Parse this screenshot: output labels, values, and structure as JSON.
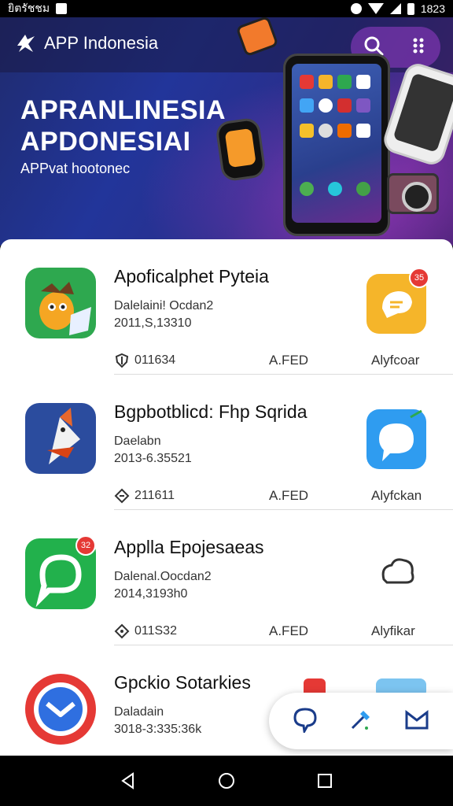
{
  "status_bar": {
    "left_text": "ยิตรัชชม",
    "time": "1823"
  },
  "header": {
    "app_name": "APP Indonesia"
  },
  "hero": {
    "title_line1": "APRANLINESIA",
    "title_line2": "APDONESIAI",
    "subtitle": "APPvat hootonec"
  },
  "apps": [
    {
      "title": "Apoficalphet Pyteia",
      "developer": "Dalelaini! Ocdan2",
      "date": "2011,S,13310",
      "count": "011634",
      "status": "A.FED",
      "action": "Alyfcoar",
      "badge": "35"
    },
    {
      "title": "Bgpbotblicd: Fhp Sqrida",
      "developer": "Daelabn",
      "date": "2013-6.35521",
      "count": "211611",
      "status": "A.FED",
      "action": "Alyfckan"
    },
    {
      "title": "Applla Epojesaeas",
      "developer": "Dalenal.Oocdan2",
      "date": "2014,3193h0",
      "count": "011S32",
      "status": "A.FED",
      "action": "Alyfikar",
      "badge": "32"
    },
    {
      "title": "Gpckio Sotarkies",
      "developer": "Daladain",
      "date": "3018-3:335:36k"
    }
  ],
  "colors": {
    "accent": "#2a359a",
    "badge": "#e53935"
  },
  "icons": {
    "header": [
      "search-icon",
      "more-vertical-icon"
    ],
    "fab": [
      "chat-icon",
      "tool-icon",
      "mail-icon"
    ],
    "nav": [
      "back-icon",
      "home-icon",
      "recents-icon"
    ]
  }
}
